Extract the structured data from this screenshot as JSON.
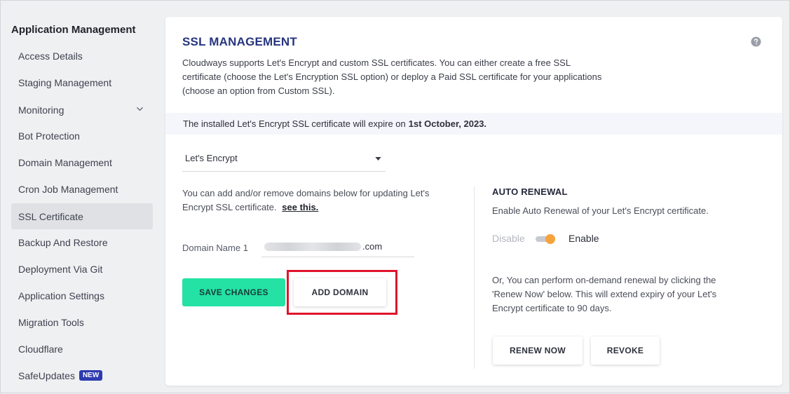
{
  "sidebar": {
    "title": "Application Management",
    "items": [
      {
        "label": "Access Details"
      },
      {
        "label": "Staging Management"
      },
      {
        "label": "Monitoring"
      },
      {
        "label": "Bot Protection"
      },
      {
        "label": "Domain Management"
      },
      {
        "label": "Cron Job Management"
      },
      {
        "label": "SSL Certificate",
        "active": true
      },
      {
        "label": "Backup And Restore"
      },
      {
        "label": "Deployment Via Git"
      },
      {
        "label": "Application Settings"
      },
      {
        "label": "Migration Tools"
      },
      {
        "label": "Cloudflare"
      },
      {
        "label": "SafeUpdates",
        "badge": "NEW"
      }
    ]
  },
  "card": {
    "title": "SSL MANAGEMENT",
    "help_icon": "question-circle-icon",
    "description": "Cloudways supports Let's Encrypt and custom SSL certificates. You can either create a free SSL certificate (choose the Let's Encryption SSL option) or deploy a Paid SSL certificate for your applications (choose an option from Custom SSL).",
    "expiry_prefix": "The installed Let's Encrypt SSL certificate will expire on",
    "expiry_date": "1st October, 2023."
  },
  "ssl_type": {
    "selected": "Let's Encrypt"
  },
  "domains": {
    "help_text": "You can add and/or remove domains below for updating Let's Encrypt SSL certificate.",
    "help_link": "see this.",
    "field_label": "Domain Name 1",
    "field_suffix": ".com"
  },
  "buttons": {
    "save": "SAVE CHANGES",
    "add_domain": "ADD DOMAIN",
    "renew_now": "RENEW NOW",
    "revoke": "REVOKE"
  },
  "auto_renewal": {
    "title": "AUTO RENEWAL",
    "description": "Enable Auto Renewal of your Let's Encrypt certificate.",
    "off_label": "Disable",
    "on_label": "Enable",
    "enabled": true,
    "on_demand_text": "Or, You can perform on-demand renewal by clicking the 'Renew Now' below. This will extend expiry of your Let's Encrypt certificate to 90 days."
  },
  "colors": {
    "title": "#27357f",
    "save_button": "#23e2a4",
    "toggle_knob": "#f5a33c",
    "highlight": "#e0152b",
    "badge": "#2d3ab0"
  }
}
